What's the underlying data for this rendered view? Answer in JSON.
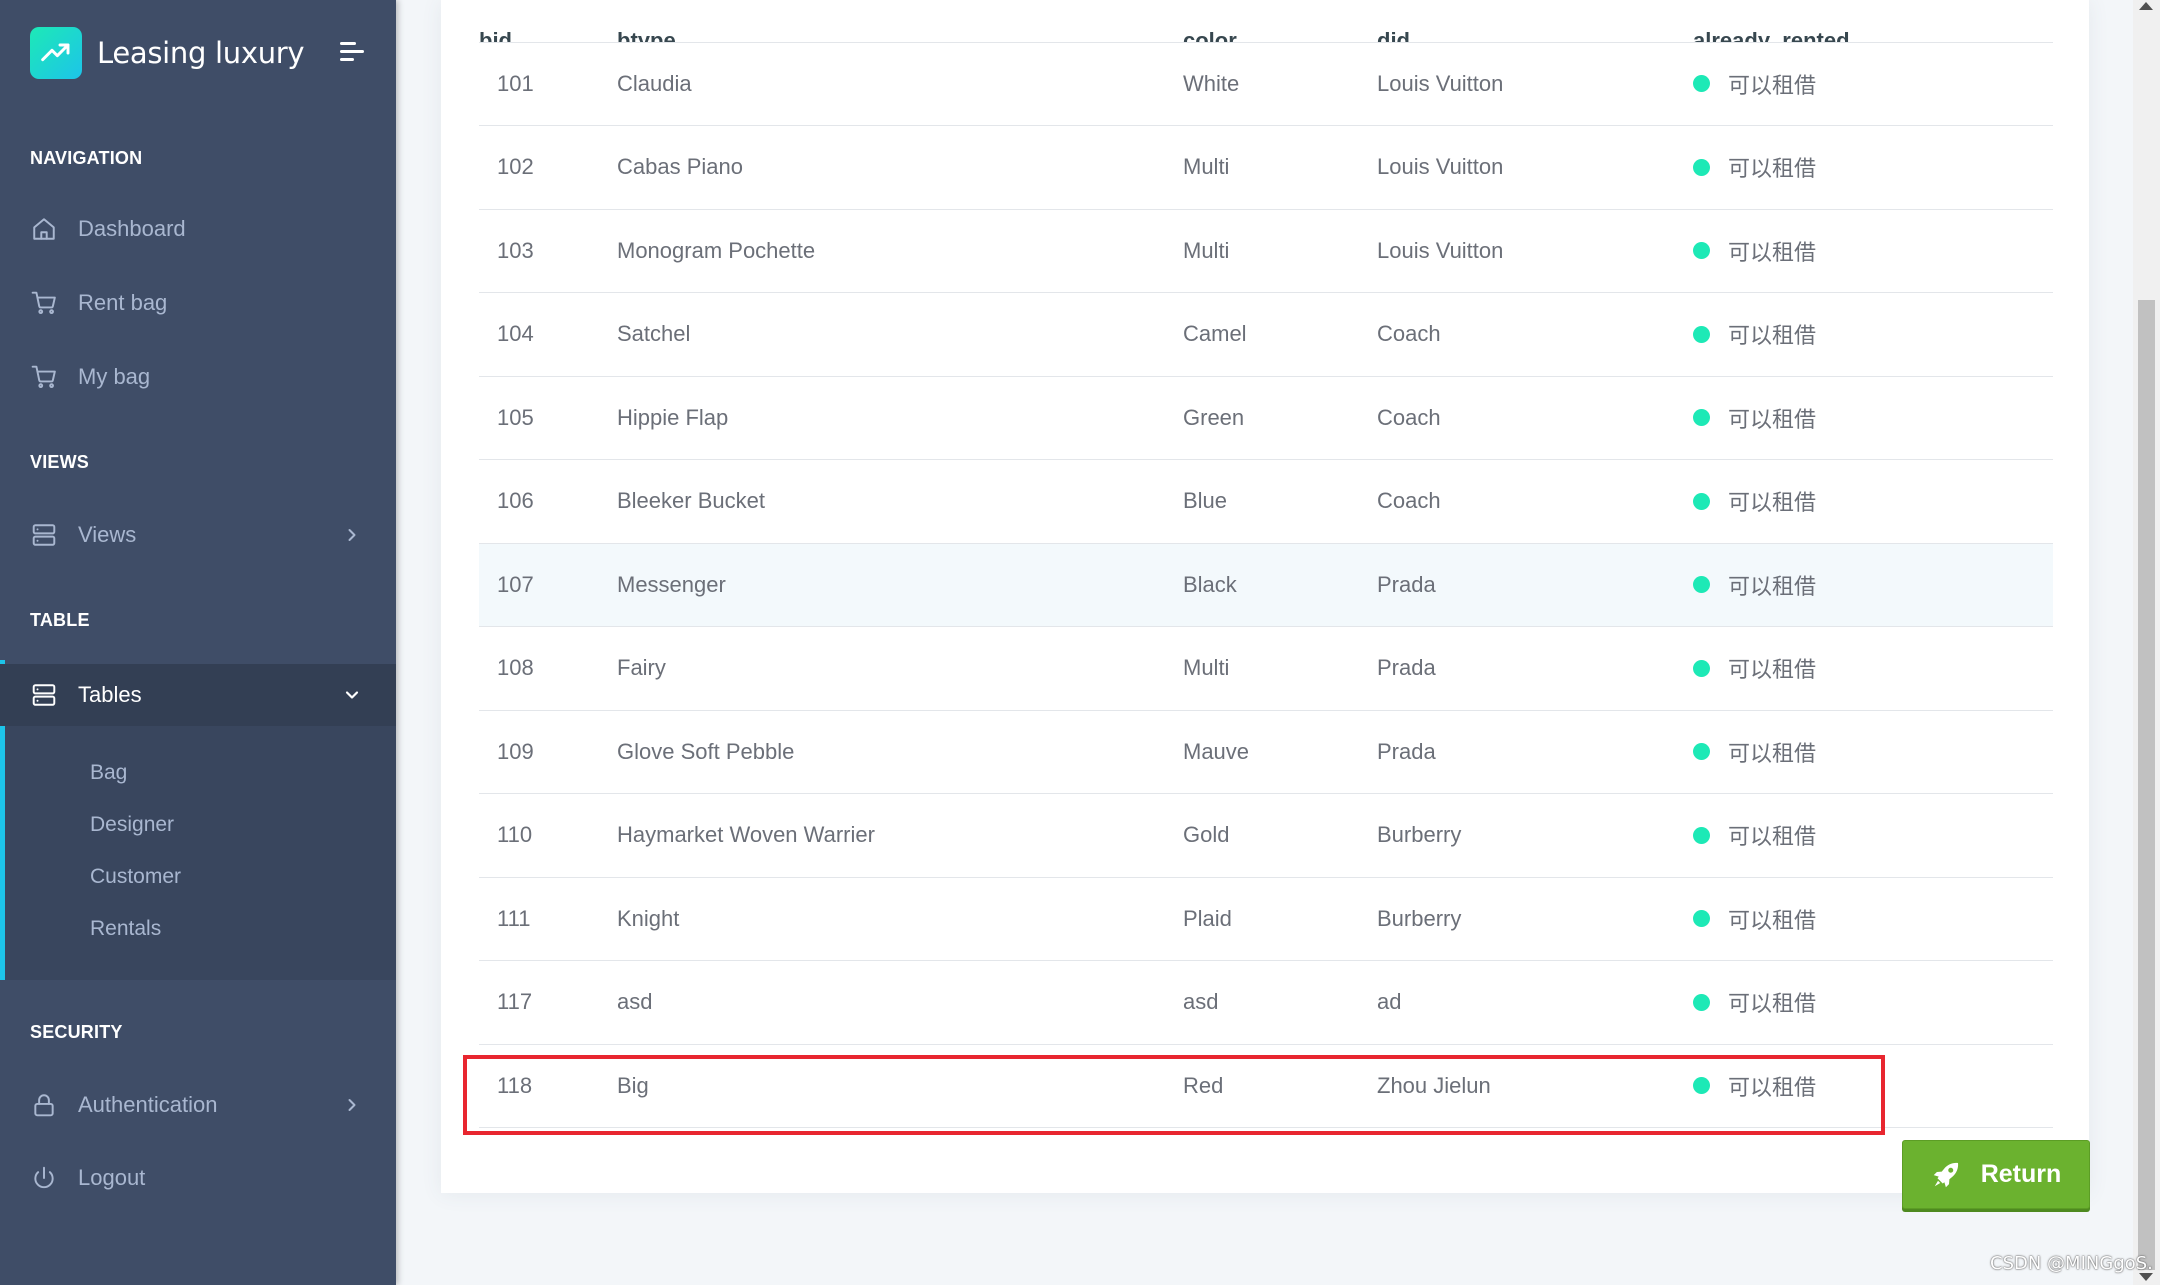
{
  "sidebar": {
    "brand": "Leasing luxury",
    "sections": {
      "navigation": "NAVIGATION",
      "views": "VIEWS",
      "table": "TABLE",
      "security": "SECURITY"
    },
    "items": {
      "dashboard": "Dashboard",
      "rent_bag": "Rent bag",
      "my_bag": "My bag",
      "views": "Views",
      "tables": "Tables",
      "authentication": "Authentication",
      "logout": "Logout"
    },
    "sub_items": [
      "Bag",
      "Designer",
      "Customer",
      "Rentals"
    ]
  },
  "table": {
    "columns": [
      "bid",
      "btype",
      "color",
      "did",
      "already_rented"
    ],
    "rows": [
      {
        "bid": "101",
        "btype": "Claudia",
        "color": "White",
        "did": "Louis Vuitton",
        "already_rented": "可以租借"
      },
      {
        "bid": "102",
        "btype": "Cabas Piano",
        "color": "Multi",
        "did": "Louis Vuitton",
        "already_rented": "可以租借"
      },
      {
        "bid": "103",
        "btype": "Monogram Pochette",
        "color": "Multi",
        "did": "Louis Vuitton",
        "already_rented": "可以租借"
      },
      {
        "bid": "104",
        "btype": "Satchel",
        "color": "Camel",
        "did": "Coach",
        "already_rented": "可以租借"
      },
      {
        "bid": "105",
        "btype": "Hippie Flap",
        "color": "Green",
        "did": "Coach",
        "already_rented": "可以租借"
      },
      {
        "bid": "106",
        "btype": "Bleeker Bucket",
        "color": "Blue",
        "did": "Coach",
        "already_rented": "可以租借"
      },
      {
        "bid": "107",
        "btype": "Messenger",
        "color": "Black",
        "did": "Prada",
        "already_rented": "可以租借"
      },
      {
        "bid": "108",
        "btype": "Fairy",
        "color": "Multi",
        "did": "Prada",
        "already_rented": "可以租借"
      },
      {
        "bid": "109",
        "btype": "Glove Soft Pebble",
        "color": "Mauve",
        "did": "Prada",
        "already_rented": "可以租借"
      },
      {
        "bid": "110",
        "btype": "Haymarket Woven Warrier",
        "color": "Gold",
        "did": "Burberry",
        "already_rented": "可以租借"
      },
      {
        "bid": "111",
        "btype": "Knight",
        "color": "Plaid",
        "did": "Burberry",
        "already_rented": "可以租借"
      },
      {
        "bid": "117",
        "btype": "asd",
        "color": "asd",
        "did": "ad",
        "already_rented": "可以租借"
      },
      {
        "bid": "118",
        "btype": "Big",
        "color": "Red",
        "did": "Zhou Jielun",
        "already_rented": "可以租借"
      }
    ]
  },
  "return_button": "Return",
  "watermark": "CSDN @MINGgoS.",
  "colors": {
    "sidebar_bg": "#3f4d67",
    "accent": "#1dc4e9",
    "status_dot": "#1de9b6",
    "return_button": "#6bb22f",
    "highlight_border": "#e8262f"
  }
}
